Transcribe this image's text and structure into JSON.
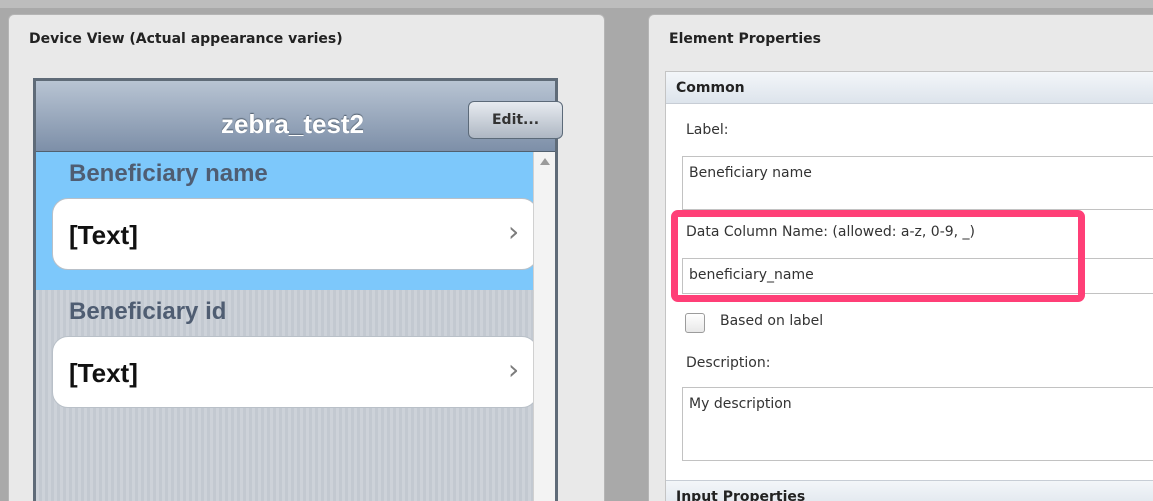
{
  "device_panel": {
    "title": "Device View (Actual appearance varies)",
    "form_title": "zebra_test2",
    "edit_label": "Edit...",
    "fields": [
      {
        "label": "Beneficiary name",
        "value": "[Text]",
        "selected": true
      },
      {
        "label": "Beneficiary id",
        "value": "[Text]",
        "selected": false
      }
    ]
  },
  "properties_panel": {
    "title": "Element Properties",
    "section_common": "Common",
    "label_caption": "Label:",
    "label_value": "Beneficiary name",
    "data_column_caption": "Data Column Name: (allowed: a-z, 0-9, _)",
    "data_column_value": "beneficiary_name",
    "based_on_label_caption": "Based on label",
    "based_on_label_checked": false,
    "description_caption": "Description:",
    "description_value": "My description",
    "section_input": "Input Properties"
  },
  "colors": {
    "selected_row": "#7dc8fb",
    "highlight_box": "#ff3f77"
  }
}
